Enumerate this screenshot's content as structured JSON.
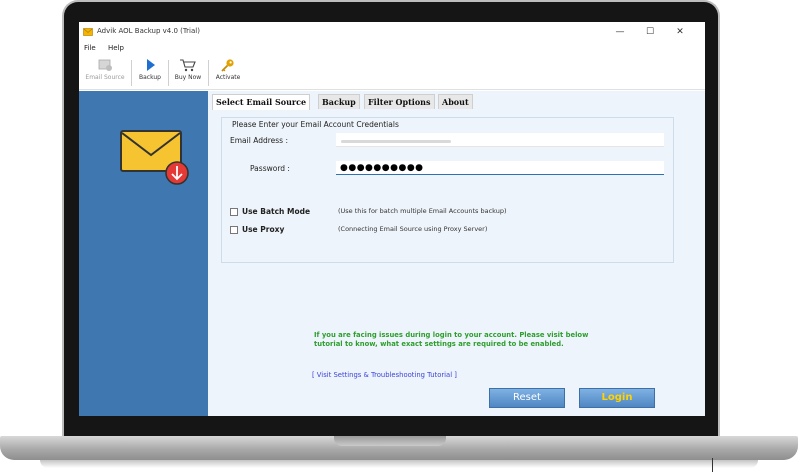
{
  "window": {
    "title": "Advik AOL Backup v4.0 (Trial)",
    "minimize_glyph": "—",
    "maximize_glyph": "☐",
    "close_glyph": "✕"
  },
  "menu": {
    "items": [
      "File",
      "Help"
    ]
  },
  "toolbar": {
    "email_source": "Email Source",
    "backup": "Backup",
    "buy_now": "Buy Now",
    "activate": "Activate"
  },
  "tabs": [
    "Select Email Source",
    "Backup",
    "Filter Options",
    "About"
  ],
  "credentials": {
    "group_title": "Please Enter your Email Account Credentials",
    "email_label": "Email Address :",
    "password_label": "Password :",
    "password_value": "●●●●●●●●●●"
  },
  "options": {
    "batch_label": "Use Batch Mode",
    "batch_desc": "(Use this for batch multiple Email Accounts backup)",
    "proxy_label": "Use Proxy",
    "proxy_desc": "(Connecting Email Source using Proxy Server)"
  },
  "info_text": "If you are facing issues during login to your account. Please visit below tutorial to know, what exact settings are required to be enabled.",
  "tutorial_link": "[ Visit Settings & Troubleshooting Tutorial ]",
  "buttons": {
    "reset": "Reset",
    "login": "Login"
  },
  "colors": {
    "left_panel": "#3f78b0",
    "content_bg": "#eef4fb",
    "info_text": "#2e9e2e",
    "link": "#3a44d8",
    "login_text": "#ffd200"
  },
  "icons": {
    "app": "envelope-app-icon",
    "email_source": "email-source-icon",
    "backup": "play-icon",
    "buy_now": "cart-icon",
    "activate": "key-icon",
    "hero": "envelope-download-icon"
  }
}
